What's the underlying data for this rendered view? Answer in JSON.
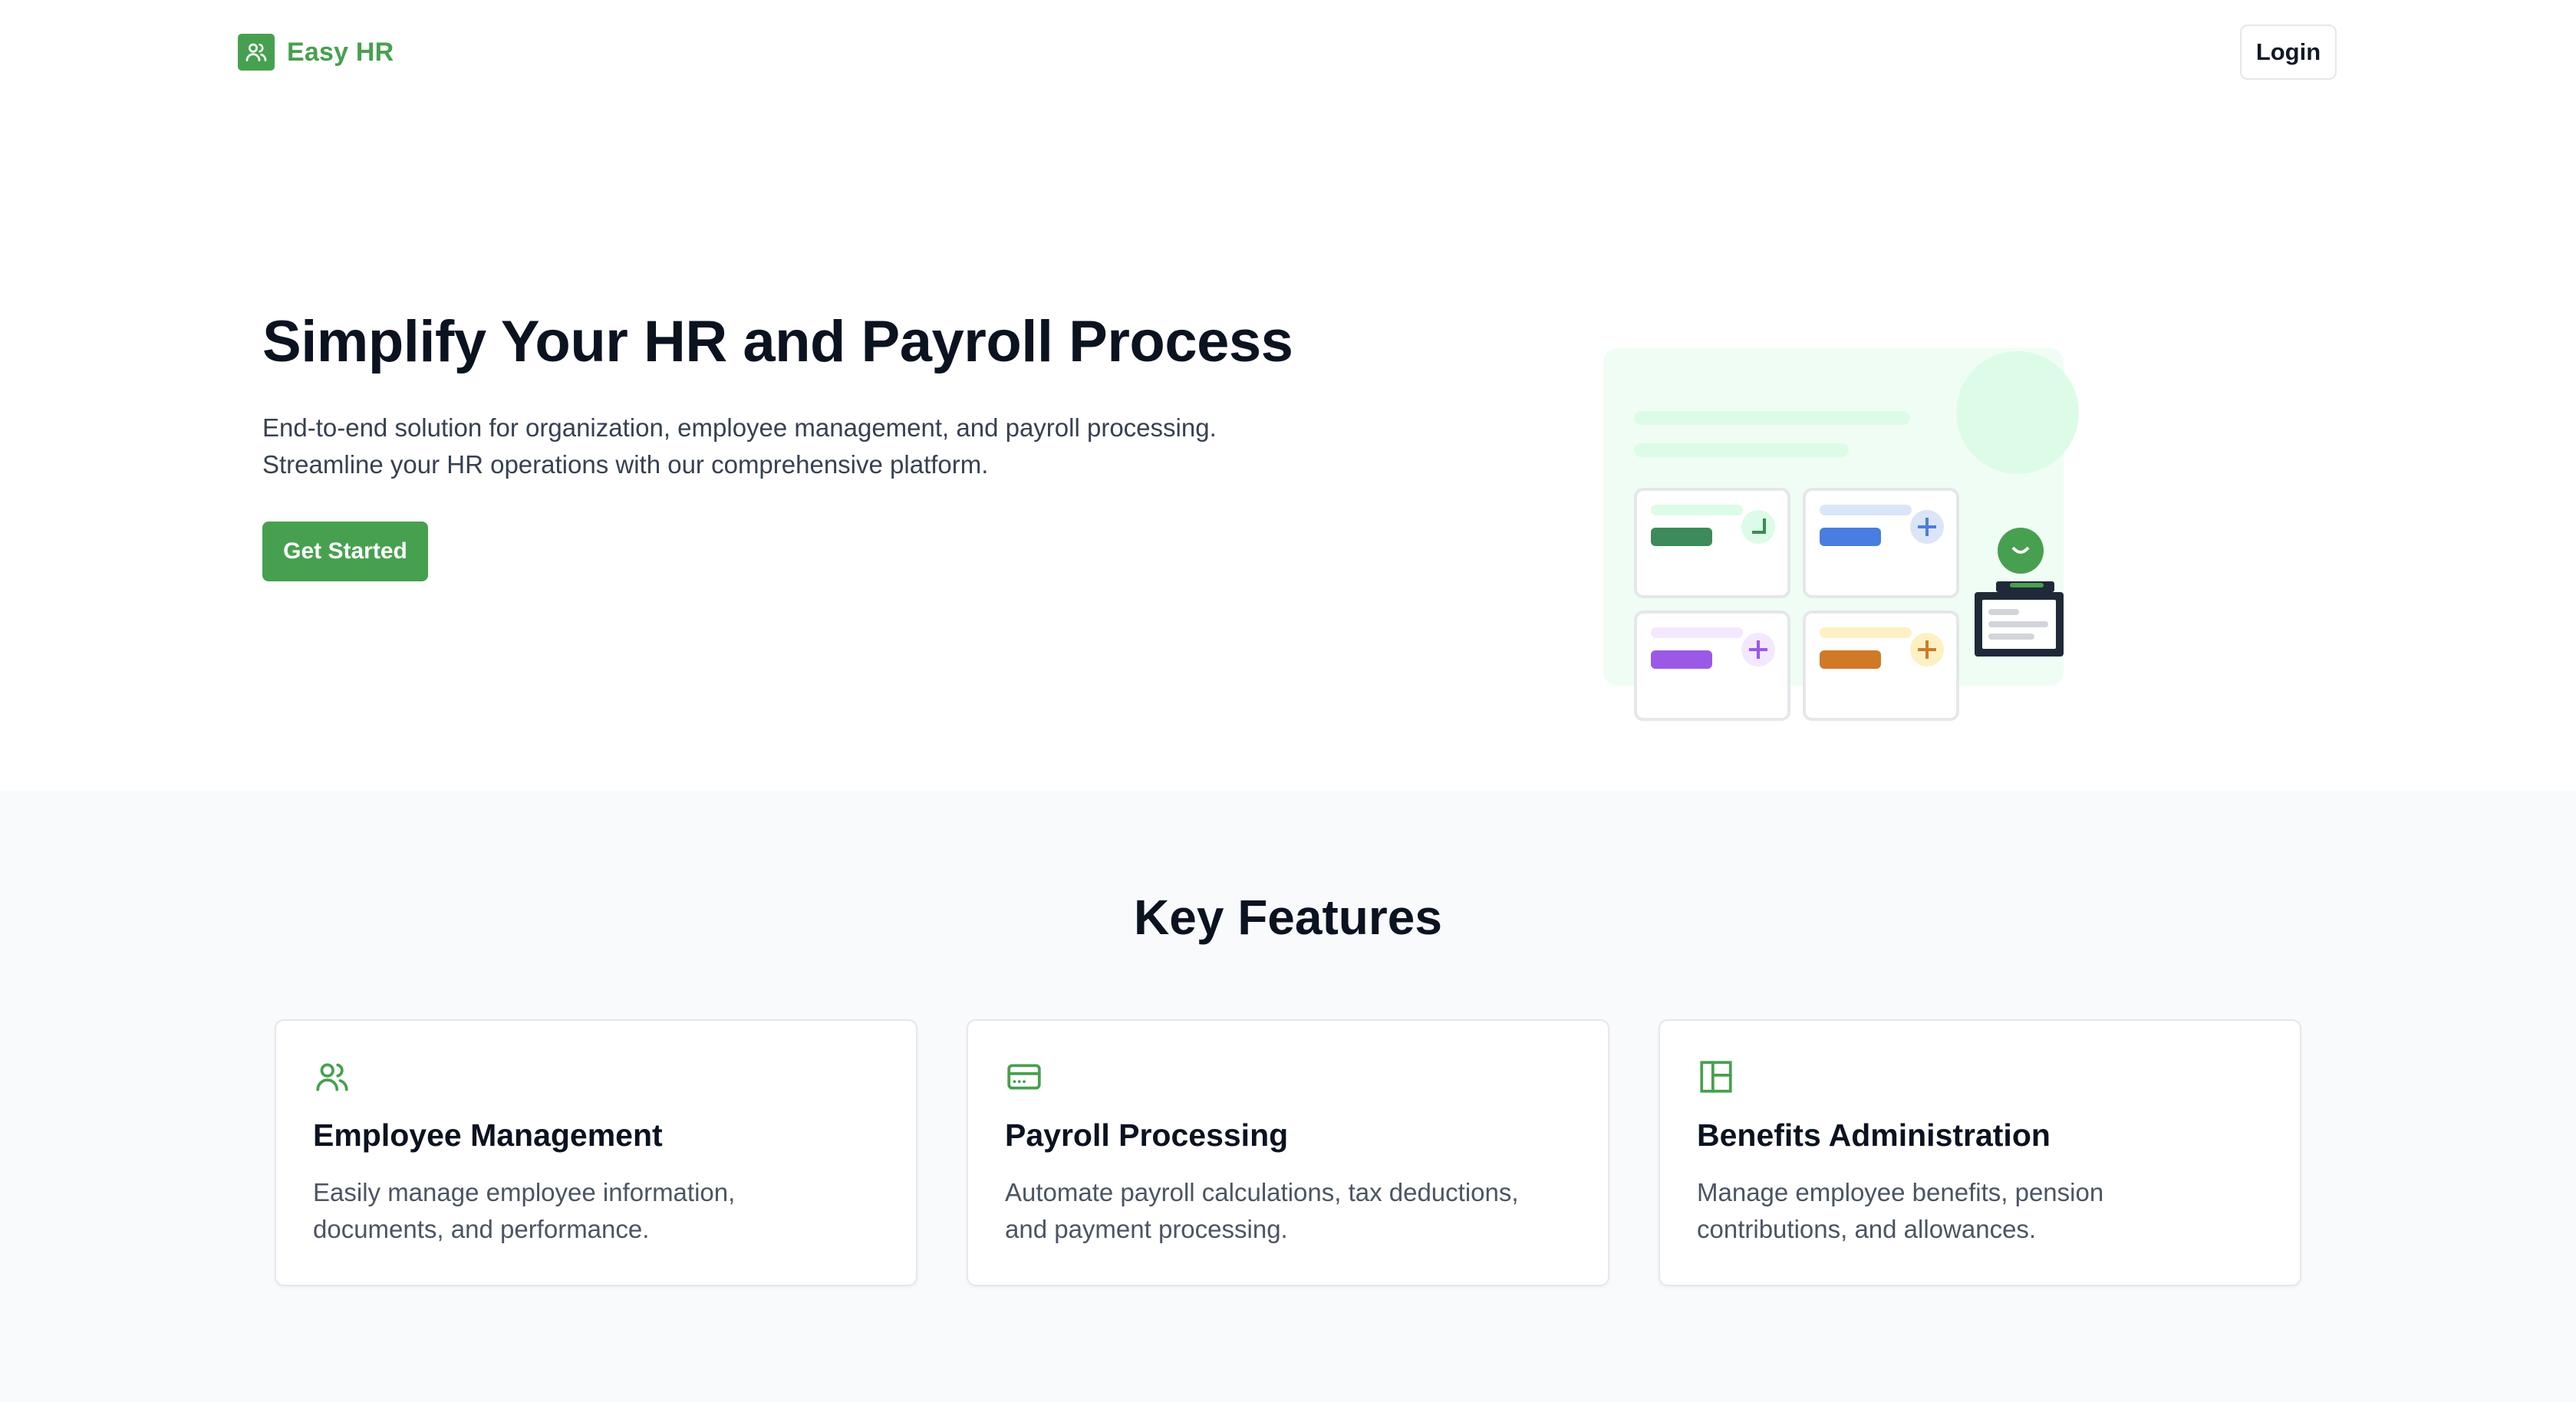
{
  "brand": {
    "name": "Easy HR",
    "icon": "users-icon",
    "color": "#47a04f"
  },
  "header": {
    "login_label": "Login"
  },
  "hero": {
    "title": "Simplify Your HR and Payroll Process",
    "description_lines": [
      "End-to-end solution for organization, employee management, and payroll processing.",
      "Streamline your HR operations with our comprehensive platform."
    ],
    "cta_label": "Get Started"
  },
  "features": {
    "title": "Key Features",
    "cards": [
      {
        "icon": "users-icon",
        "title": "Employee Management",
        "description_lines": [
          "Easily manage employee information,",
          "documents, and performance."
        ]
      },
      {
        "icon": "credit-card-icon",
        "title": "Payroll Processing",
        "description_lines": [
          "Automate payroll calculations, tax deductions,",
          "and payment processing."
        ]
      },
      {
        "icon": "layout-icon",
        "title": "Benefits Administration",
        "description_lines": [
          "Manage employee benefits, pension",
          "contributions, and allowances."
        ]
      }
    ]
  },
  "colors": {
    "accent": "#47a04f",
    "heading": "#0b1220",
    "body_text": "#374151",
    "section_bg": "#f9fafb",
    "card_border": "#e5e7eb"
  }
}
